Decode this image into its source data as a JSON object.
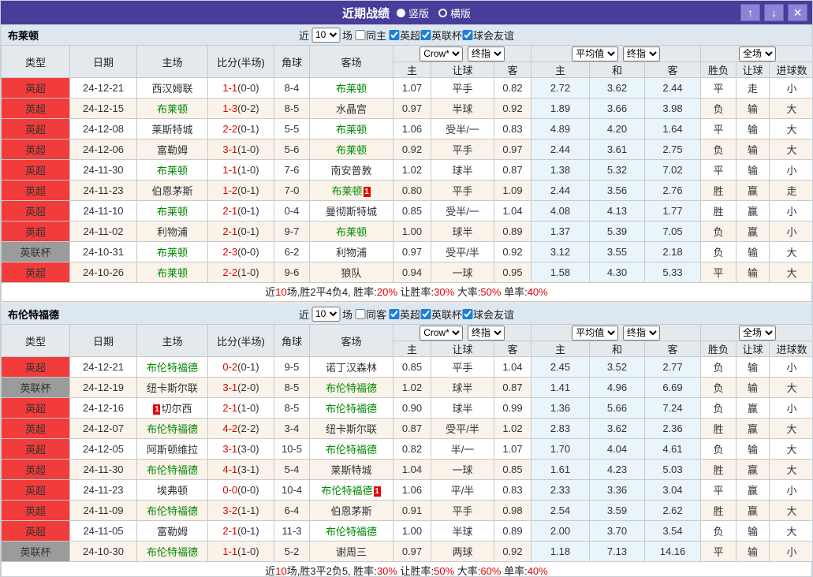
{
  "titlebar": {
    "title": "近期战绩",
    "radio_options": [
      {
        "label": "竖版",
        "selected": true
      },
      {
        "label": "横版",
        "selected": false
      }
    ],
    "buttons": {
      "up": "↑",
      "down": "↓",
      "close": "✕"
    }
  },
  "colors": {
    "titlebar_bg": "#483d99",
    "titlebar_button_bg": "#8e84d6",
    "league_red_bg": "#f23b3b",
    "league_gray_bg": "#9b9b9b",
    "score_red": "#e60000",
    "team_green": "#008800",
    "result_red": "#e60000",
    "result_blue": "#1010cc",
    "result_green": "#008800",
    "avg_col_bg": "#e9f4fb",
    "alt_row_bg": "#faf3ea",
    "checkbox_blue": "#1d7fd6"
  },
  "filter_labels": {
    "near": "近",
    "games": "场"
  },
  "table_header": {
    "type": "类型",
    "date": "日期",
    "home": "主场",
    "score": "比分(半场)",
    "corner": "角球",
    "away": "客场",
    "crow_select": "Crow*",
    "final_select": "终指",
    "avg_select": "平均值",
    "final2_select": "终指",
    "full_select": "全场",
    "sub": [
      "主",
      "让球",
      "客",
      "主",
      "和",
      "客",
      "胜负",
      "让球",
      "进球数"
    ]
  },
  "sections": [
    {
      "team": "布莱顿",
      "filter": {
        "count": "10",
        "same_label": "同主",
        "leagues": [
          "英超",
          "英联杯",
          "球会友谊"
        ]
      },
      "rows": [
        {
          "type": "英超",
          "gray": false,
          "date": "24-12-21",
          "home": {
            "name": "西汉姆联",
            "self": false
          },
          "score": "1-1",
          "half": "(0-0)",
          "corner": "8-4",
          "away": {
            "name": "布莱顿",
            "self": true
          },
          "odds": [
            "1.07",
            "平手",
            "0.82"
          ],
          "avg": [
            "2.72",
            "3.62",
            "2.44"
          ],
          "res": [
            [
              "平",
              "g"
            ],
            [
              "走",
              "g"
            ],
            [
              "小",
              "b"
            ]
          ]
        },
        {
          "type": "英超",
          "gray": false,
          "date": "24-12-15",
          "home": {
            "name": "布莱顿",
            "self": true
          },
          "score": "1-3",
          "half": "(0-2)",
          "corner": "8-5",
          "away": {
            "name": "水晶宫",
            "self": false
          },
          "odds": [
            "0.97",
            "半球",
            "0.92"
          ],
          "avg": [
            "1.89",
            "3.66",
            "3.98"
          ],
          "res": [
            [
              "负",
              "b"
            ],
            [
              "输",
              "b"
            ],
            [
              "大",
              "r"
            ]
          ]
        },
        {
          "type": "英超",
          "gray": false,
          "date": "24-12-08",
          "home": {
            "name": "莱斯特城",
            "self": false
          },
          "score": "2-2",
          "half": "(0-1)",
          "corner": "5-5",
          "away": {
            "name": "布莱顿",
            "self": true
          },
          "odds": [
            "1.06",
            "受半/一",
            "0.83"
          ],
          "avg": [
            "4.89",
            "4.20",
            "1.64"
          ],
          "res": [
            [
              "平",
              "g"
            ],
            [
              "输",
              "b"
            ],
            [
              "大",
              "r"
            ]
          ]
        },
        {
          "type": "英超",
          "gray": false,
          "date": "24-12-06",
          "home": {
            "name": "富勒姆",
            "self": false
          },
          "score": "3-1",
          "half": "(1-0)",
          "corner": "5-6",
          "away": {
            "name": "布莱顿",
            "self": true
          },
          "odds": [
            "0.92",
            "平手",
            "0.97"
          ],
          "avg": [
            "2.44",
            "3.61",
            "2.75"
          ],
          "res": [
            [
              "负",
              "b"
            ],
            [
              "输",
              "b"
            ],
            [
              "大",
              "r"
            ]
          ]
        },
        {
          "type": "英超",
          "gray": false,
          "date": "24-11-30",
          "home": {
            "name": "布莱顿",
            "self": true
          },
          "score": "1-1",
          "half": "(1-0)",
          "corner": "7-6",
          "away": {
            "name": "南安普敦",
            "self": false
          },
          "odds": [
            "1.02",
            "球半",
            "0.87"
          ],
          "avg": [
            "1.38",
            "5.32",
            "7.02"
          ],
          "res": [
            [
              "平",
              "g"
            ],
            [
              "输",
              "b"
            ],
            [
              "小",
              "b"
            ]
          ]
        },
        {
          "type": "英超",
          "gray": false,
          "date": "24-11-23",
          "home": {
            "name": "伯恩茅斯",
            "self": false
          },
          "score": "1-2",
          "half": "(0-1)",
          "corner": "7-0",
          "away": {
            "name": "布莱顿",
            "self": true,
            "badge": "1",
            "badge_pos": "after"
          },
          "odds": [
            "0.80",
            "平手",
            "1.09"
          ],
          "avg": [
            "2.44",
            "3.56",
            "2.76"
          ],
          "res": [
            [
              "胜",
              "r"
            ],
            [
              "赢",
              "r"
            ],
            [
              "走",
              "g"
            ]
          ]
        },
        {
          "type": "英超",
          "gray": false,
          "date": "24-11-10",
          "home": {
            "name": "布莱顿",
            "self": true
          },
          "score": "2-1",
          "half": "(0-1)",
          "corner": "0-4",
          "away": {
            "name": "曼彻斯特城",
            "self": false
          },
          "odds": [
            "0.85",
            "受半/一",
            "1.04"
          ],
          "avg": [
            "4.08",
            "4.13",
            "1.77"
          ],
          "res": [
            [
              "胜",
              "r"
            ],
            [
              "赢",
              "r"
            ],
            [
              "小",
              "b"
            ]
          ]
        },
        {
          "type": "英超",
          "gray": false,
          "date": "24-11-02",
          "home": {
            "name": "利物浦",
            "self": false
          },
          "score": "2-1",
          "half": "(0-1)",
          "corner": "9-7",
          "away": {
            "name": "布莱顿",
            "self": true
          },
          "odds": [
            "1.00",
            "球半",
            "0.89"
          ],
          "avg": [
            "1.37",
            "5.39",
            "7.05"
          ],
          "res": [
            [
              "负",
              "b"
            ],
            [
              "赢",
              "r"
            ],
            [
              "小",
              "b"
            ]
          ]
        },
        {
          "type": "英联杯",
          "gray": true,
          "date": "24-10-31",
          "home": {
            "name": "布莱顿",
            "self": true
          },
          "score": "2-3",
          "half": "(0-0)",
          "corner": "6-2",
          "away": {
            "name": "利物浦",
            "self": false
          },
          "odds": [
            "0.97",
            "受平/半",
            "0.92"
          ],
          "avg": [
            "3.12",
            "3.55",
            "2.18"
          ],
          "res": [
            [
              "负",
              "b"
            ],
            [
              "输",
              "b"
            ],
            [
              "大",
              "r"
            ]
          ]
        },
        {
          "type": "英超",
          "gray": false,
          "date": "24-10-26",
          "home": {
            "name": "布莱顿",
            "self": true
          },
          "score": "2-2",
          "half": "(1-0)",
          "corner": "9-6",
          "away": {
            "name": "狼队",
            "self": false
          },
          "odds": [
            "0.94",
            "一球",
            "0.95"
          ],
          "avg": [
            "1.58",
            "4.30",
            "5.33"
          ],
          "res": [
            [
              "平",
              "g"
            ],
            [
              "输",
              "b"
            ],
            [
              "大",
              "r"
            ]
          ]
        }
      ],
      "summary": [
        {
          "text": "近",
          "red": false
        },
        {
          "text": "10",
          "red": true
        },
        {
          "text": "场,胜2平4负4, 胜率:",
          "red": false
        },
        {
          "text": "20%",
          "red": true
        },
        {
          "text": " 让胜率:",
          "red": false
        },
        {
          "text": "30%",
          "red": true
        },
        {
          "text": " 大率:",
          "red": false
        },
        {
          "text": "50%",
          "red": true
        },
        {
          "text": " 单率:",
          "red": false
        },
        {
          "text": "40%",
          "red": true
        }
      ]
    },
    {
      "team": "布伦特福德",
      "filter": {
        "count": "10",
        "same_label": "同客",
        "leagues": [
          "英超",
          "英联杯",
          "球会友谊"
        ]
      },
      "rows": [
        {
          "type": "英超",
          "gray": false,
          "date": "24-12-21",
          "home": {
            "name": "布伦特福德",
            "self": true
          },
          "score": "0-2",
          "half": "(0-1)",
          "corner": "9-5",
          "away": {
            "name": "诺丁汉森林",
            "self": false
          },
          "odds": [
            "0.85",
            "平手",
            "1.04"
          ],
          "avg": [
            "2.45",
            "3.52",
            "2.77"
          ],
          "res": [
            [
              "负",
              "b"
            ],
            [
              "输",
              "b"
            ],
            [
              "小",
              "b"
            ]
          ]
        },
        {
          "type": "英联杯",
          "gray": true,
          "date": "24-12-19",
          "home": {
            "name": "纽卡斯尔联",
            "self": false
          },
          "score": "3-1",
          "half": "(2-0)",
          "corner": "8-5",
          "away": {
            "name": "布伦特福德",
            "self": true
          },
          "odds": [
            "1.02",
            "球半",
            "0.87"
          ],
          "avg": [
            "1.41",
            "4.96",
            "6.69"
          ],
          "res": [
            [
              "负",
              "b"
            ],
            [
              "输",
              "b"
            ],
            [
              "大",
              "r"
            ]
          ]
        },
        {
          "type": "英超",
          "gray": false,
          "date": "24-12-16",
          "home": {
            "name": "切尔西",
            "self": false,
            "badge": "1",
            "badge_pos": "before"
          },
          "score": "2-1",
          "half": "(1-0)",
          "corner": "8-5",
          "away": {
            "name": "布伦特福德",
            "self": true
          },
          "odds": [
            "0.90",
            "球半",
            "0.99"
          ],
          "avg": [
            "1.36",
            "5.66",
            "7.24"
          ],
          "res": [
            [
              "负",
              "b"
            ],
            [
              "赢",
              "r"
            ],
            [
              "小",
              "b"
            ]
          ]
        },
        {
          "type": "英超",
          "gray": false,
          "date": "24-12-07",
          "home": {
            "name": "布伦特福德",
            "self": true
          },
          "score": "4-2",
          "half": "(2-2)",
          "corner": "3-4",
          "away": {
            "name": "纽卡斯尔联",
            "self": false
          },
          "odds": [
            "0.87",
            "受平/半",
            "1.02"
          ],
          "avg": [
            "2.83",
            "3.62",
            "2.36"
          ],
          "res": [
            [
              "胜",
              "r"
            ],
            [
              "赢",
              "r"
            ],
            [
              "大",
              "r"
            ]
          ]
        },
        {
          "type": "英超",
          "gray": false,
          "date": "24-12-05",
          "home": {
            "name": "阿斯顿维拉",
            "self": false
          },
          "score": "3-1",
          "half": "(3-0)",
          "corner": "10-5",
          "away": {
            "name": "布伦特福德",
            "self": true
          },
          "odds": [
            "0.82",
            "半/一",
            "1.07"
          ],
          "avg": [
            "1.70",
            "4.04",
            "4.61"
          ],
          "res": [
            [
              "负",
              "b"
            ],
            [
              "输",
              "b"
            ],
            [
              "大",
              "r"
            ]
          ]
        },
        {
          "type": "英超",
          "gray": false,
          "date": "24-11-30",
          "home": {
            "name": "布伦特福德",
            "self": true
          },
          "score": "4-1",
          "half": "(3-1)",
          "corner": "5-4",
          "away": {
            "name": "莱斯特城",
            "self": false
          },
          "odds": [
            "1.04",
            "一球",
            "0.85"
          ],
          "avg": [
            "1.61",
            "4.23",
            "5.03"
          ],
          "res": [
            [
              "胜",
              "r"
            ],
            [
              "赢",
              "r"
            ],
            [
              "大",
              "r"
            ]
          ]
        },
        {
          "type": "英超",
          "gray": false,
          "date": "24-11-23",
          "home": {
            "name": "埃弗顿",
            "self": false
          },
          "score": "0-0",
          "half": "(0-0)",
          "corner": "10-4",
          "away": {
            "name": "布伦特福德",
            "self": true,
            "badge": "1",
            "badge_pos": "after"
          },
          "odds": [
            "1.06",
            "平/半",
            "0.83"
          ],
          "avg": [
            "2.33",
            "3.36",
            "3.04"
          ],
          "res": [
            [
              "平",
              "g"
            ],
            [
              "赢",
              "r"
            ],
            [
              "小",
              "b"
            ]
          ]
        },
        {
          "type": "英超",
          "gray": false,
          "date": "24-11-09",
          "home": {
            "name": "布伦特福德",
            "self": true
          },
          "score": "3-2",
          "half": "(1-1)",
          "corner": "6-4",
          "away": {
            "name": "伯恩茅斯",
            "self": false
          },
          "odds": [
            "0.91",
            "平手",
            "0.98"
          ],
          "avg": [
            "2.54",
            "3.59",
            "2.62"
          ],
          "res": [
            [
              "胜",
              "r"
            ],
            [
              "赢",
              "r"
            ],
            [
              "大",
              "r"
            ]
          ]
        },
        {
          "type": "英超",
          "gray": false,
          "date": "24-11-05",
          "home": {
            "name": "富勒姆",
            "self": false
          },
          "score": "2-1",
          "half": "(0-1)",
          "corner": "11-3",
          "away": {
            "name": "布伦特福德",
            "self": true
          },
          "odds": [
            "1.00",
            "半球",
            "0.89"
          ],
          "avg": [
            "2.00",
            "3.70",
            "3.54"
          ],
          "res": [
            [
              "负",
              "b"
            ],
            [
              "输",
              "b"
            ],
            [
              "大",
              "r"
            ]
          ]
        },
        {
          "type": "英联杯",
          "gray": true,
          "date": "24-10-30",
          "home": {
            "name": "布伦特福德",
            "self": true
          },
          "score": "1-1",
          "half": "(1-0)",
          "corner": "5-2",
          "away": {
            "name": "谢周三",
            "self": false
          },
          "odds": [
            "0.97",
            "两球",
            "0.92"
          ],
          "avg": [
            "1.18",
            "7.13",
            "14.16"
          ],
          "res": [
            [
              "平",
              "g"
            ],
            [
              "输",
              "b"
            ],
            [
              "小",
              "b"
            ]
          ]
        }
      ],
      "summary": [
        {
          "text": "近",
          "red": false
        },
        {
          "text": "10",
          "red": true
        },
        {
          "text": "场,胜3平2负5, 胜率:",
          "red": false
        },
        {
          "text": "30%",
          "red": true
        },
        {
          "text": " 让胜率:",
          "red": false
        },
        {
          "text": "50%",
          "red": true
        },
        {
          "text": " 大率:",
          "red": false
        },
        {
          "text": "60%",
          "red": true
        },
        {
          "text": " 单率:",
          "red": false
        },
        {
          "text": "40%",
          "red": true
        }
      ]
    }
  ]
}
